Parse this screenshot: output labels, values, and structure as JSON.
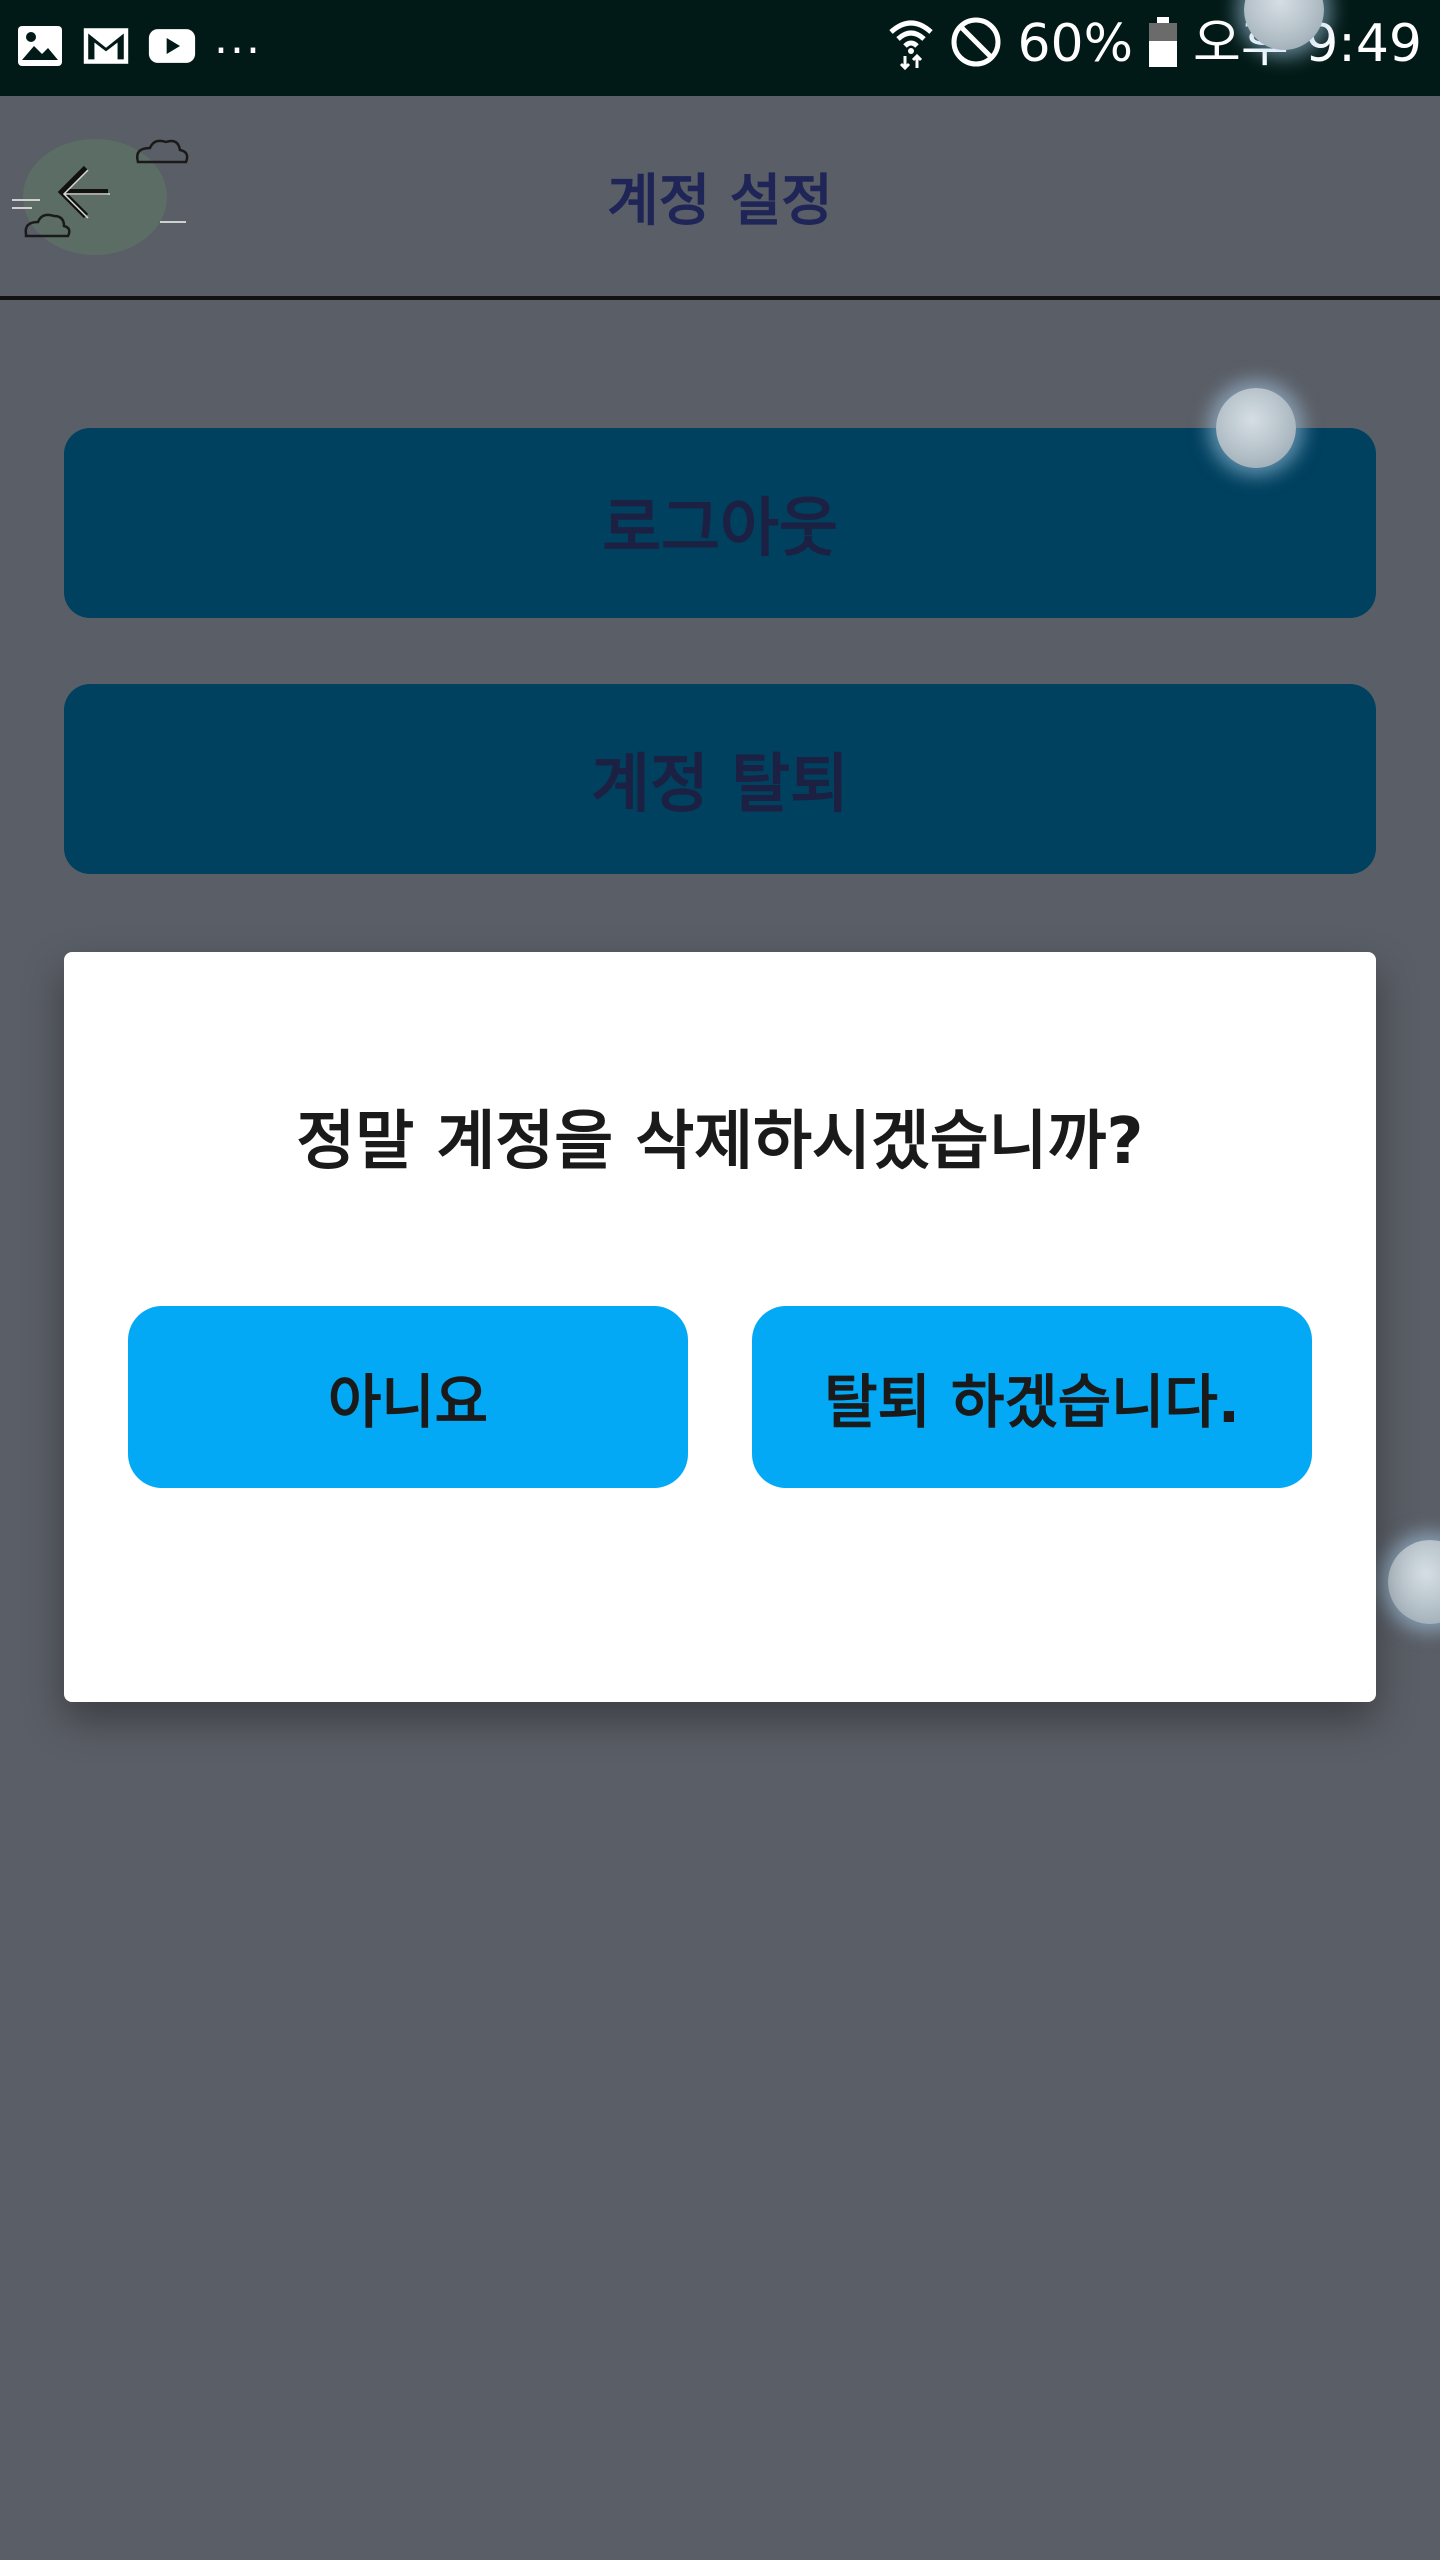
{
  "status_bar": {
    "dots": "...",
    "battery": "60%",
    "time": "오후 9:49",
    "icons": [
      "gallery-icon",
      "gmail-icon",
      "youtube-icon",
      "wifi-icon",
      "do-not-disturb-icon",
      "battery-icon"
    ]
  },
  "header": {
    "title": "계정 설정",
    "back_icon": "back-arrow-icon"
  },
  "actions": {
    "logout_label": "로그아웃",
    "withdraw_label": "계정 탈퇴"
  },
  "dialog": {
    "message": "정말 계정을 삭제하시겠습니까?",
    "no_label": "아니요",
    "yes_label": "탈퇴 하겠습니다."
  },
  "colors": {
    "status_bar": "#021a17",
    "overlay_background": "#5a5e66",
    "action_button": "#00415f",
    "dialog_button": "#03a9f4",
    "title_text": "#1f2557"
  }
}
